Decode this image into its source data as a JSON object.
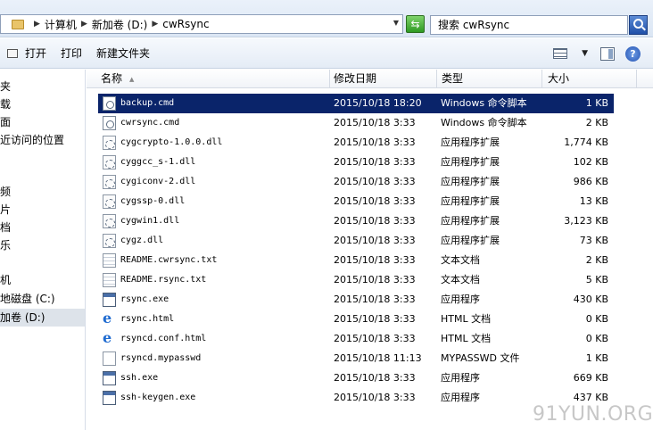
{
  "address": {
    "breadcrumbs": [
      "计算机",
      "新加卷 (D:)",
      "cwRsync"
    ]
  },
  "search": {
    "placeholder": "搜索 cwRsync"
  },
  "toolbar": {
    "open_label": "打开",
    "print_label": "打印",
    "new_folder_label": "新建文件夹"
  },
  "nav": {
    "items": [
      "夹",
      "载",
      "面",
      "近访问的位置",
      "频",
      "片",
      "档",
      "乐",
      "机",
      "地磁盘 (C:)",
      "加卷 (D:)"
    ],
    "selected_index": 10
  },
  "columns": {
    "name": "名称",
    "date": "修改日期",
    "type": "类型",
    "size": "大小"
  },
  "files": [
    {
      "name": "backup.cmd",
      "date": "2015/10/18 18:20",
      "type": "Windows 命令脚本",
      "size": "1 KB",
      "icon": "cmd",
      "selected": true
    },
    {
      "name": "cwrsync.cmd",
      "date": "2015/10/18 3:33",
      "type": "Windows 命令脚本",
      "size": "2 KB",
      "icon": "cmd"
    },
    {
      "name": "cygcrypto-1.0.0.dll",
      "date": "2015/10/18 3:33",
      "type": "应用程序扩展",
      "size": "1,774 KB",
      "icon": "dll"
    },
    {
      "name": "cyggcc_s-1.dll",
      "date": "2015/10/18 3:33",
      "type": "应用程序扩展",
      "size": "102 KB",
      "icon": "dll"
    },
    {
      "name": "cygiconv-2.dll",
      "date": "2015/10/18 3:33",
      "type": "应用程序扩展",
      "size": "986 KB",
      "icon": "dll"
    },
    {
      "name": "cygssp-0.dll",
      "date": "2015/10/18 3:33",
      "type": "应用程序扩展",
      "size": "13 KB",
      "icon": "dll"
    },
    {
      "name": "cygwin1.dll",
      "date": "2015/10/18 3:33",
      "type": "应用程序扩展",
      "size": "3,123 KB",
      "icon": "dll"
    },
    {
      "name": "cygz.dll",
      "date": "2015/10/18 3:33",
      "type": "应用程序扩展",
      "size": "73 KB",
      "icon": "dll"
    },
    {
      "name": "README.cwrsync.txt",
      "date": "2015/10/18 3:33",
      "type": "文本文档",
      "size": "2 KB",
      "icon": "txt"
    },
    {
      "name": "README.rsync.txt",
      "date": "2015/10/18 3:33",
      "type": "文本文档",
      "size": "5 KB",
      "icon": "txt"
    },
    {
      "name": "rsync.exe",
      "date": "2015/10/18 3:33",
      "type": "应用程序",
      "size": "430 KB",
      "icon": "exe"
    },
    {
      "name": "rsync.html",
      "date": "2015/10/18 3:33",
      "type": "HTML 文档",
      "size": "0 KB",
      "icon": "html"
    },
    {
      "name": "rsyncd.conf.html",
      "date": "2015/10/18 3:33",
      "type": "HTML 文档",
      "size": "0 KB",
      "icon": "html"
    },
    {
      "name": "rsyncd.mypasswd",
      "date": "2015/10/18 11:13",
      "type": "MYPASSWD 文件",
      "size": "1 KB",
      "icon": "file"
    },
    {
      "name": "ssh.exe",
      "date": "2015/10/18 3:33",
      "type": "应用程序",
      "size": "669 KB",
      "icon": "exe"
    },
    {
      "name": "ssh-keygen.exe",
      "date": "2015/10/18 3:33",
      "type": "应用程序",
      "size": "437 KB",
      "icon": "exe"
    }
  ],
  "watermark": "91YUN.ORG",
  "colors": {
    "selection": "#0a246a",
    "accent": "#2f9a23"
  }
}
